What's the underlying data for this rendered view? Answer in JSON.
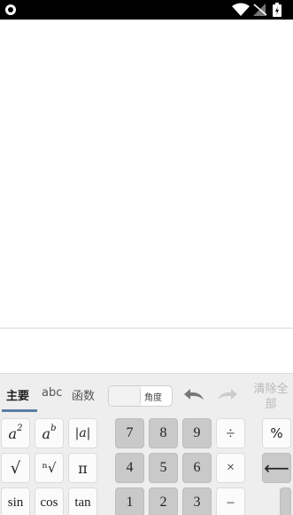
{
  "status_bar": {
    "icons": [
      "notification-icon",
      "wifi-icon",
      "signal-icon",
      "battery-icon"
    ]
  },
  "keyboard": {
    "tabs": [
      {
        "label": "主要",
        "active": true
      },
      {
        "label": "abc",
        "active": false
      },
      {
        "label": "函数",
        "active": false
      }
    ],
    "angle_toggle_label": "角度",
    "clear_all_label": "清除全部",
    "accent_color": "#5a7fa6",
    "function_keys": {
      "square": {
        "base": "a",
        "exp": "2"
      },
      "power": {
        "base": "a",
        "exp": "b"
      },
      "abs": "|a|",
      "sqrt": "√",
      "nroot": "ⁿ√",
      "pi": "π",
      "sin": "sin",
      "cos": "cos",
      "tan": "tan"
    },
    "number_keys": [
      "7",
      "8",
      "9",
      "4",
      "5",
      "6",
      "1",
      "2",
      "3"
    ],
    "operator_keys": [
      "÷",
      "×",
      "–"
    ],
    "right_keys": {
      "percent": "%",
      "backspace": "⟵"
    }
  }
}
